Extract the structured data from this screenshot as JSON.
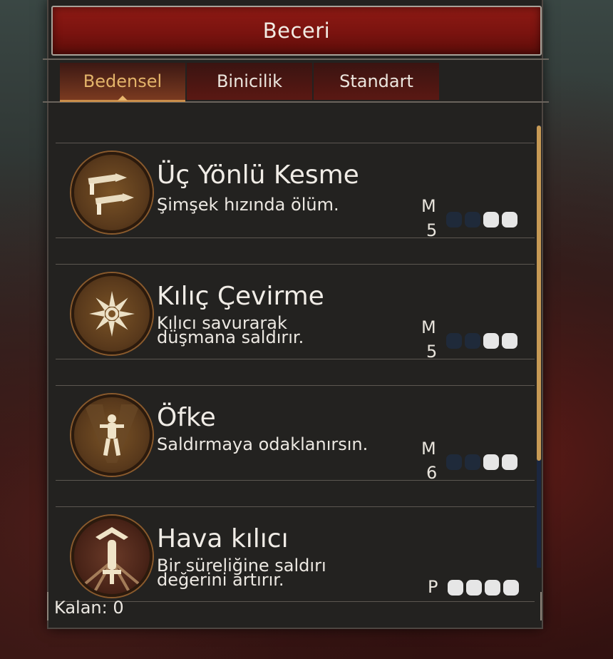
{
  "window": {
    "title": "Beceri"
  },
  "tabs": [
    {
      "label": "Bedensel",
      "active": true
    },
    {
      "label": "Binicilik",
      "active": false
    },
    {
      "label": "Standart",
      "active": false
    }
  ],
  "skills": [
    {
      "name": "Üç Yönlü Kesme",
      "description": "Şimşek hızında ölüm.",
      "rank": "M",
      "level": "5",
      "icon": "triple-slash-icon",
      "pips_filled": 2,
      "pips_total": 4
    },
    {
      "name": "Kılıç Çevirme",
      "description": "Kılıcı savurarak düşmana saldırır.",
      "rank": "M",
      "level": "5",
      "icon": "blade-spin-icon",
      "pips_filled": 2,
      "pips_total": 4
    },
    {
      "name": "Öfke",
      "description": "Saldırmaya odaklanırsın.",
      "rank": "M",
      "level": "6",
      "icon": "rage-figure-icon",
      "pips_filled": 2,
      "pips_total": 4
    },
    {
      "name": "Hava kılıcı",
      "description": "Bir süreliğine saldırı değerini artırır.",
      "rank": "P",
      "level": "",
      "icon": "air-sword-icon",
      "pips_filled": 4,
      "pips_total": 4
    }
  ],
  "footer": {
    "remaining_label": "Kalan: 0"
  },
  "colors": {
    "title_red": "#7a130f",
    "accent_gold": "#e3b46a",
    "pip_on": "#e6e6e6",
    "pip_off": "#1f2a3a"
  }
}
